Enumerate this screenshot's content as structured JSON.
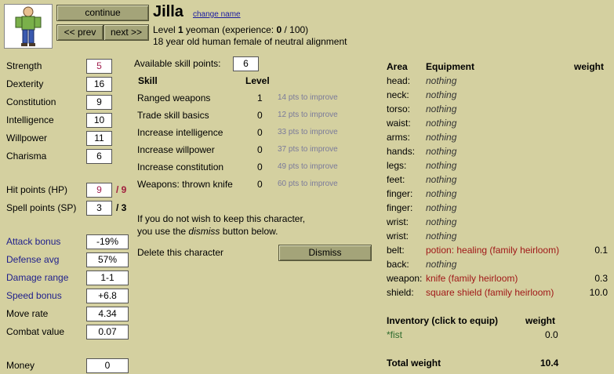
{
  "header": {
    "continue_label": "continue",
    "prev_label": "<< prev",
    "next_label": "next >>",
    "char_name": "Jilla",
    "change_name_label": "change name",
    "level_prefix": "Level ",
    "level": "1",
    "level_suffix": " yeoman (experience: ",
    "exp": "0",
    "exp_suffix": " / 100)",
    "description": "18 year old human female of neutral alignment"
  },
  "stats": [
    {
      "label": "Strength",
      "value": "5"
    },
    {
      "label": "Dexterity",
      "value": "16"
    },
    {
      "label": "Constitution",
      "value": "9"
    },
    {
      "label": "Intelligence",
      "value": "10"
    },
    {
      "label": "Willpower",
      "value": "11"
    },
    {
      "label": "Charisma",
      "value": "6"
    }
  ],
  "points": {
    "hp_label": "Hit points (HP)",
    "hp": "9",
    "hp_max": "/ 9",
    "sp_label": "Spell points (SP)",
    "sp": "3",
    "sp_max": "/ 3"
  },
  "combat": [
    {
      "label": "Attack bonus",
      "value": "-19%"
    },
    {
      "label": "Defense avg",
      "value": "57%"
    },
    {
      "label": "Damage range",
      "value": "1-1"
    },
    {
      "label": "Speed bonus",
      "value": "+6.8"
    },
    {
      "label": "Move rate",
      "value": "4.34"
    },
    {
      "label": "Combat value",
      "value": "0.07"
    }
  ],
  "money": {
    "label": "Money",
    "value": "0"
  },
  "skills": {
    "available_label": "Available skill points:",
    "available": "6",
    "col_skill": "Skill",
    "col_level": "Level",
    "rows": [
      {
        "name": "Ranged weapons",
        "level": "1",
        "improve": "14 pts to improve"
      },
      {
        "name": "Trade skill basics",
        "level": "0",
        "improve": "12 pts to improve"
      },
      {
        "name": "Increase intelligence",
        "level": "0",
        "improve": "33 pts to improve"
      },
      {
        "name": "Increase willpower",
        "level": "0",
        "improve": "37 pts to improve"
      },
      {
        "name": "Increase constitution",
        "level": "0",
        "improve": "49 pts to improve"
      },
      {
        "name": "Weapons: thrown knife",
        "level": "0",
        "improve": "60 pts to improve"
      }
    ]
  },
  "dismiss": {
    "note_line1": "If you do not wish to keep this character,",
    "note_line2_a": "you use the ",
    "note_line2_em": "dismiss",
    "note_line2_b": " button below.",
    "delete_label": "Delete this character",
    "dismiss_label": "Dismiss"
  },
  "equipment": {
    "col_area": "Area",
    "col_equipment": "Equipment",
    "col_weight": "weight",
    "rows": [
      {
        "area": "head:",
        "item": "nothing",
        "weight": "",
        "special": false
      },
      {
        "area": "neck:",
        "item": "nothing",
        "weight": "",
        "special": false
      },
      {
        "area": "torso:",
        "item": "nothing",
        "weight": "",
        "special": false
      },
      {
        "area": "waist:",
        "item": "nothing",
        "weight": "",
        "special": false
      },
      {
        "area": "arms:",
        "item": "nothing",
        "weight": "",
        "special": false
      },
      {
        "area": "hands:",
        "item": "nothing",
        "weight": "",
        "special": false
      },
      {
        "area": "legs:",
        "item": "nothing",
        "weight": "",
        "special": false
      },
      {
        "area": "feet:",
        "item": "nothing",
        "weight": "",
        "special": false
      },
      {
        "area": "finger:",
        "item": "nothing",
        "weight": "",
        "special": false
      },
      {
        "area": "finger:",
        "item": "nothing",
        "weight": "",
        "special": false
      },
      {
        "area": "wrist:",
        "item": "nothing",
        "weight": "",
        "special": false
      },
      {
        "area": "wrist:",
        "item": "nothing",
        "weight": "",
        "special": false
      },
      {
        "area": "belt:",
        "item": "potion: healing (family heirloom)",
        "weight": "0.1",
        "special": true
      },
      {
        "area": "back:",
        "item": "nothing",
        "weight": "",
        "special": false
      },
      {
        "area": "weapon:",
        "item": "knife (family heirloom)",
        "weight": "0.3",
        "special": true
      },
      {
        "area": "shield:",
        "item": "square shield (family heirloom)",
        "weight": "10.0",
        "special": true
      }
    ]
  },
  "inventory": {
    "title": "Inventory (click to equip)",
    "col_weight": "weight",
    "items": [
      {
        "name": "*fist",
        "weight": "0.0"
      }
    ],
    "total_label": "Total weight",
    "total": "10.4"
  },
  "colors": {
    "background": "#d4d0a0",
    "button": "#a4a479",
    "link": "#1a1aa0",
    "highlight": "#a01c4c"
  }
}
